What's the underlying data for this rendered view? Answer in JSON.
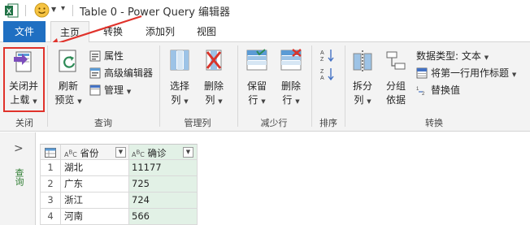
{
  "window": {
    "title": "Table 0 - Power Query 编辑器"
  },
  "tabs": {
    "file": "文件",
    "home": "主页",
    "transform": "转换",
    "add_column": "添加列",
    "view": "视图"
  },
  "ribbon": {
    "close": {
      "btn_line1": "关闭并",
      "btn_line2": "上载",
      "group": "关闭"
    },
    "query": {
      "refresh_line1": "刷新",
      "refresh_line2": "预览",
      "properties": "属性",
      "advanced_editor": "高级编辑器",
      "manage": "管理",
      "group": "查询"
    },
    "manage_columns": {
      "choose_line1": "选择",
      "choose_line2": "列",
      "remove_line1": "删除",
      "remove_line2": "列",
      "group": "管理列"
    },
    "reduce_rows": {
      "keep_line1": "保留",
      "keep_line2": "行",
      "remove_line1": "删除",
      "remove_line2": "行",
      "group": "减少行"
    },
    "sort": {
      "group": "排序"
    },
    "transform": {
      "split_line1": "拆分",
      "split_line2": "列",
      "group_line1": "分组",
      "group_line2": "依据",
      "data_type": "数据类型: 文本",
      "use_first_row": "将第一行用作标题",
      "replace_values": "替换值",
      "group": "转换"
    }
  },
  "left_pane": {
    "label": "查询"
  },
  "table": {
    "columns": [
      "省份",
      "确诊"
    ],
    "rows": [
      {
        "index": "1",
        "province": "湖北",
        "value": "11177"
      },
      {
        "index": "2",
        "province": "广东",
        "value": "725"
      },
      {
        "index": "3",
        "province": "浙江",
        "value": "724"
      },
      {
        "index": "4",
        "province": "河南",
        "value": "566"
      }
    ]
  },
  "colors": {
    "file_tab": "#1f6fc2",
    "highlight": "#e0322b",
    "value_column": "#e2f1e6"
  }
}
